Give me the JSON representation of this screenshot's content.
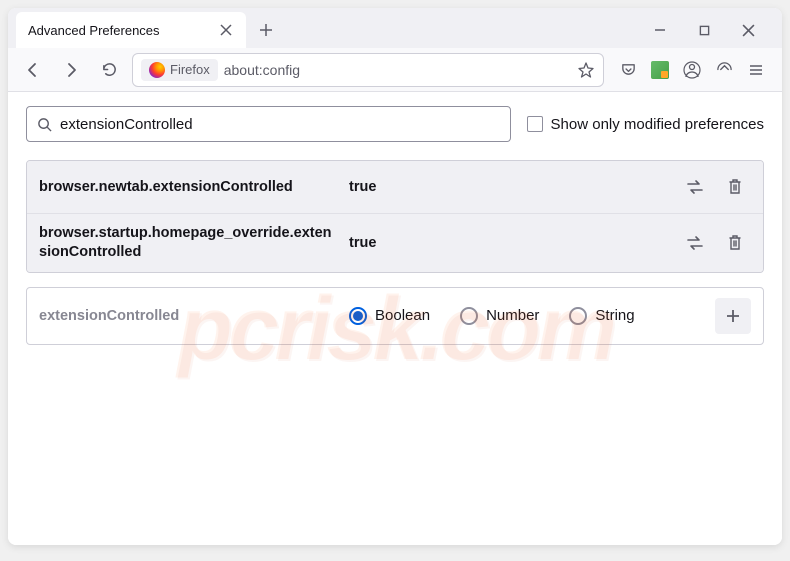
{
  "tab": {
    "title": "Advanced Preferences"
  },
  "address": {
    "label": "Firefox",
    "url": "about:config"
  },
  "search": {
    "value": "extensionControlled"
  },
  "checkbox": {
    "label": "Show only modified preferences"
  },
  "prefs": [
    {
      "name": "browser.newtab.extensionControlled",
      "value": "true"
    },
    {
      "name": "browser.startup.homepage_override.extensionControlled",
      "value": "true"
    }
  ],
  "newPref": {
    "name": "extensionControlled",
    "types": [
      "Boolean",
      "Number",
      "String"
    ],
    "selected": 0
  },
  "watermark": "pcrisk.com"
}
